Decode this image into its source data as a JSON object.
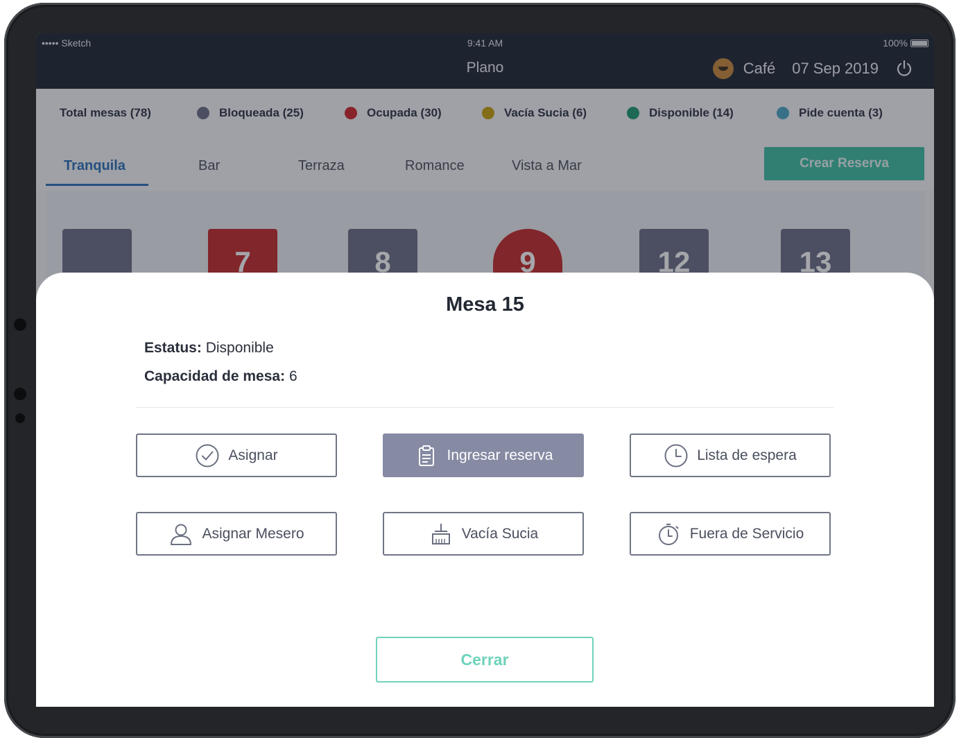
{
  "status_bar": {
    "carrier": "••••• Sketch",
    "time": "9:41 AM",
    "battery": "100%"
  },
  "header": {
    "title": "Plano",
    "venue": "Café",
    "date": "07 Sep 2019",
    "icons": [
      "cafe-logo-icon",
      "power-icon"
    ]
  },
  "legend": {
    "total": "Total mesas (78)",
    "items": [
      {
        "label": "Bloqueada (25)",
        "color": "#6b6f87"
      },
      {
        "label": "Ocupada (30)",
        "color": "#d0252b"
      },
      {
        "label": "Vacía Sucia (6)",
        "color": "#c9a10c"
      },
      {
        "label": "Disponible (14)",
        "color": "#1e9a73"
      },
      {
        "label": "Pide cuenta (3)",
        "color": "#4aa6c6"
      }
    ]
  },
  "tabs": [
    {
      "label": "Tranquila",
      "active": true
    },
    {
      "label": "Bar",
      "active": false
    },
    {
      "label": "Terraza",
      "active": false
    },
    {
      "label": "Romance",
      "active": false
    },
    {
      "label": "Vista a Mar",
      "active": false
    }
  ],
  "create_button": "Crear Reserva",
  "floor_tables": [
    {
      "number": "",
      "status": "Bloqueada",
      "color": "#6b6f87"
    },
    {
      "number": "7",
      "status": "Ocupada",
      "color": "#c42b2b"
    },
    {
      "number": "8",
      "status": "Bloqueada",
      "color": "#6b6f87"
    },
    {
      "number": "9",
      "status": "Ocupada",
      "color": "#c42b2b"
    },
    {
      "number": "12",
      "status": "Bloqueada",
      "color": "#6b6f87"
    },
    {
      "number": "13",
      "status": "Bloqueada",
      "color": "#6b6f87"
    }
  ],
  "modal": {
    "title": "Mesa 15",
    "status_label": "Estatus:",
    "status_value": "Disponible",
    "capacity_label": "Capacidad de mesa:",
    "capacity_value": "6",
    "actions": [
      {
        "label": "Asignar",
        "icon": "check-circle-icon"
      },
      {
        "label": "Ingresar reserva",
        "icon": "clipboard-icon"
      },
      {
        "label": "Lista de espera",
        "icon": "clock-icon"
      },
      {
        "label": "Asignar Mesero",
        "icon": "user-icon"
      },
      {
        "label": "Vacía Sucia",
        "icon": "broom-icon"
      },
      {
        "label": "Fuera de Servicio",
        "icon": "stopwatch-icon"
      }
    ],
    "close_button": "Cerrar"
  }
}
